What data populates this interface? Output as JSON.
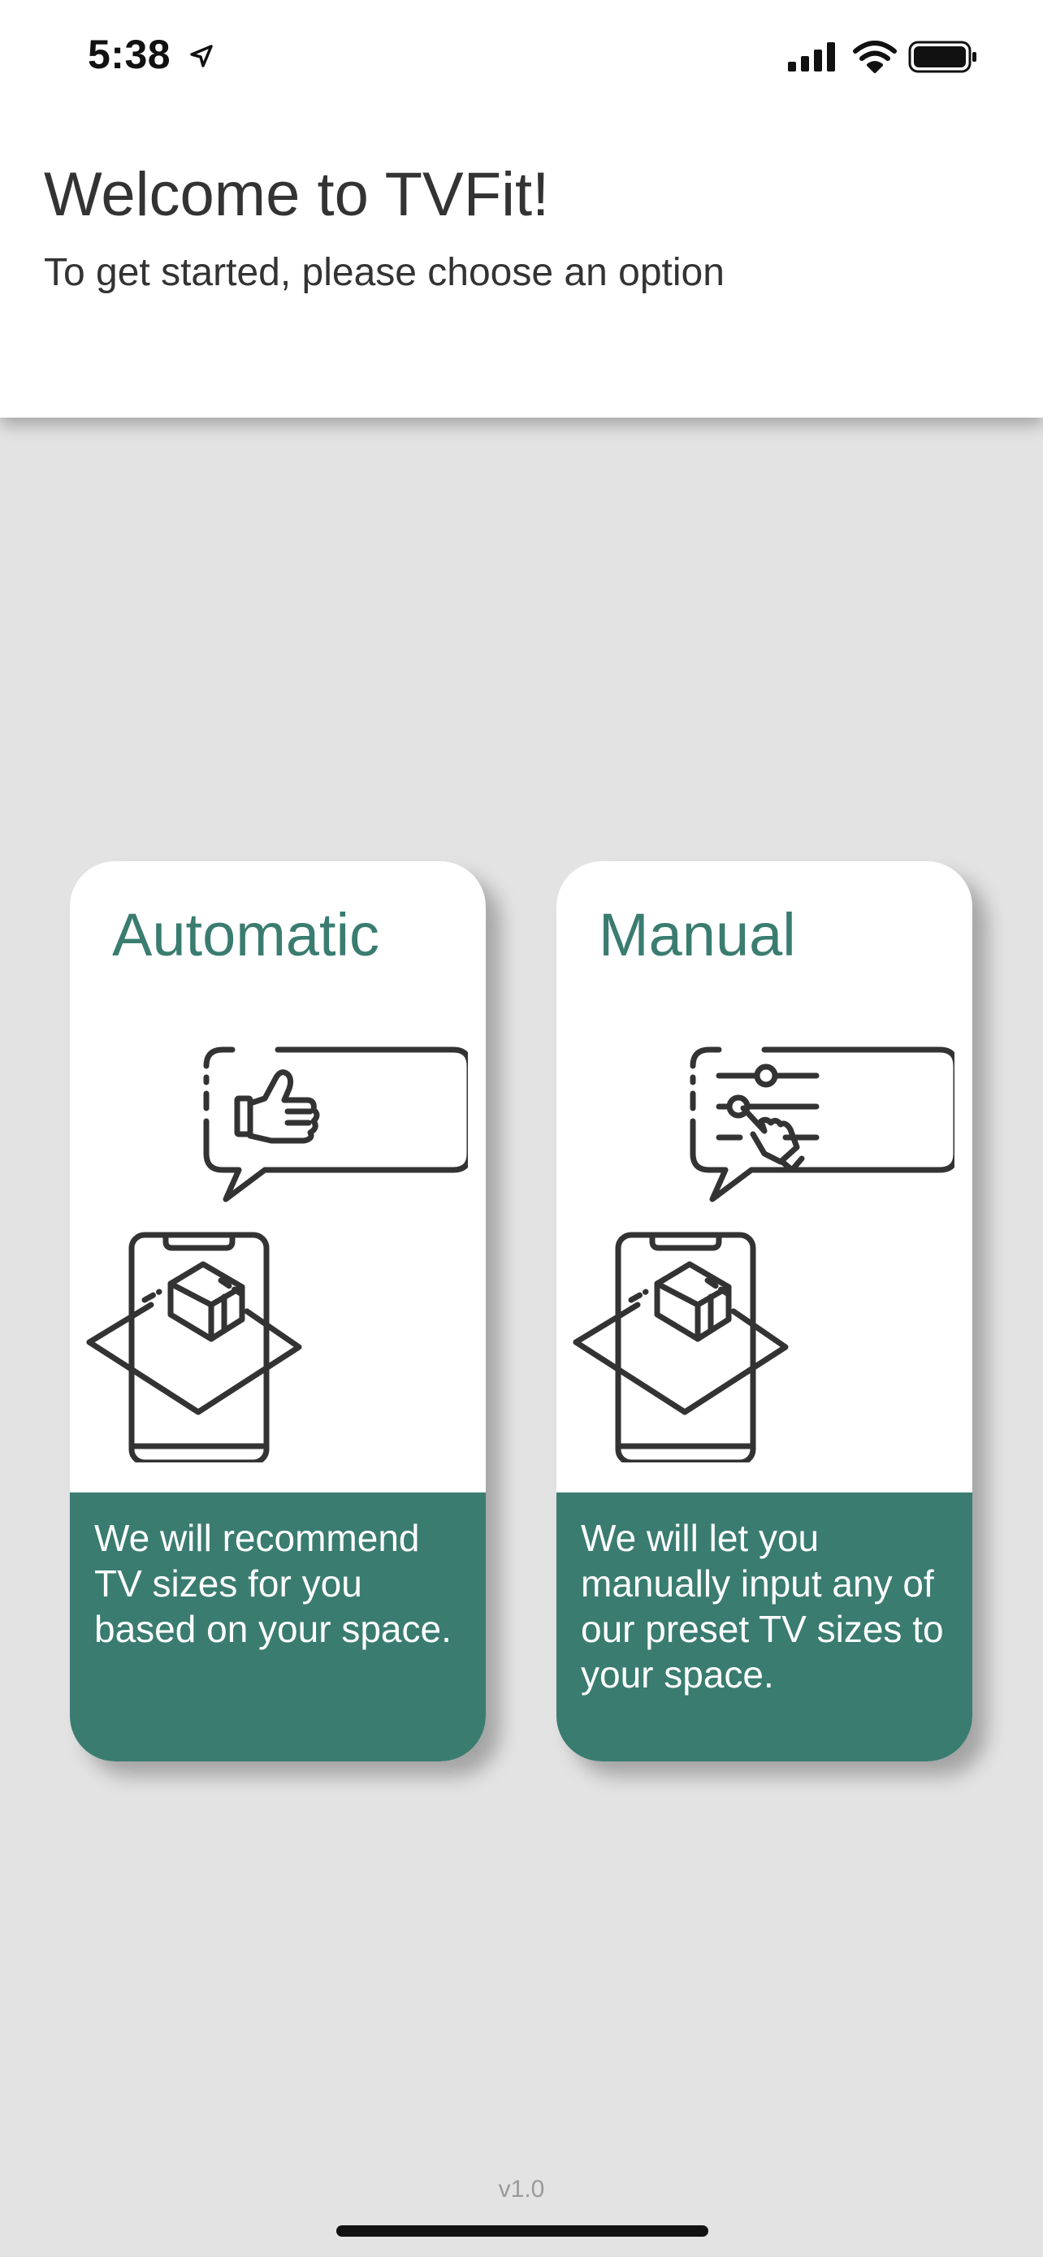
{
  "status_bar": {
    "time": "5:38"
  },
  "header": {
    "title": "Welcome to TVFit!",
    "subtitle": "To get started, please choose an option"
  },
  "cards": [
    {
      "title": "Automatic",
      "description": "We will recommend TV sizes for you based on your space.",
      "icon": "phone-ar-thumbs-up-icon"
    },
    {
      "title": "Manual",
      "description": "We will let you manually input any of our preset TV sizes to your space.",
      "icon": "phone-ar-sliders-icon"
    }
  ],
  "footer": {
    "version": "v1.0"
  },
  "colors": {
    "accent": "#3a7c70",
    "background": "#e3e3e3",
    "header": "#ffffff",
    "text": "#333333"
  }
}
